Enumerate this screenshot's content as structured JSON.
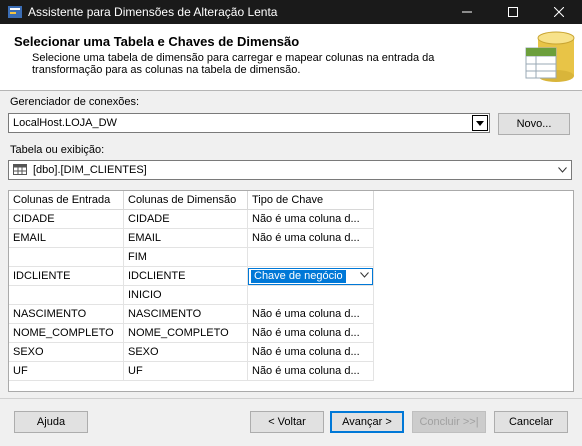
{
  "window": {
    "title": "Assistente para Dimensões de Alteração Lenta",
    "controls": [
      "minimize",
      "maximize",
      "close"
    ]
  },
  "header": {
    "title": "Selecionar uma Tabela e Chaves de Dimensão",
    "description": "Selecione uma tabela de dimensão para carregar e mapear colunas na entrada da transformação para as colunas na tabela de dimensão."
  },
  "connection": {
    "label": "Gerenciador de conexões:",
    "value": "LocalHost.LOJA_DW",
    "new_button": "Novo..."
  },
  "table": {
    "label": "Tabela ou exibição:",
    "value": "[dbo].[DIM_CLIENTES]"
  },
  "grid": {
    "headers": [
      "Colunas de Entrada",
      "Colunas de Dimensão",
      "Tipo de Chave"
    ],
    "rows": [
      {
        "input": "CIDADE",
        "dimension": "CIDADE",
        "key": "Não é uma coluna d..."
      },
      {
        "input": "EMAIL",
        "dimension": "EMAIL",
        "key": "Não é uma coluna d..."
      },
      {
        "input": "",
        "dimension": "FIM",
        "key": ""
      },
      {
        "input": "IDCLIENTE",
        "dimension": "IDCLIENTE",
        "key": "Chave de negócio",
        "editing": true
      },
      {
        "input": "",
        "dimension": "INICIO",
        "key": ""
      },
      {
        "input": "NASCIMENTO",
        "dimension": "NASCIMENTO",
        "key": "Não é uma coluna d..."
      },
      {
        "input": "NOME_COMPLETO",
        "dimension": "NOME_COMPLETO",
        "key": "Não é uma coluna d..."
      },
      {
        "input": "SEXO",
        "dimension": "SEXO",
        "key": "Não é uma coluna d..."
      },
      {
        "input": "UF",
        "dimension": "UF",
        "key": "Não é uma coluna d..."
      }
    ]
  },
  "footer": {
    "help": "Ajuda",
    "back": "< Voltar",
    "next": "Avançar >",
    "finish": "Concluir >>|",
    "cancel": "Cancelar"
  },
  "colors": {
    "titlebar": "#1a1a1a",
    "accent": "#0078d7"
  }
}
